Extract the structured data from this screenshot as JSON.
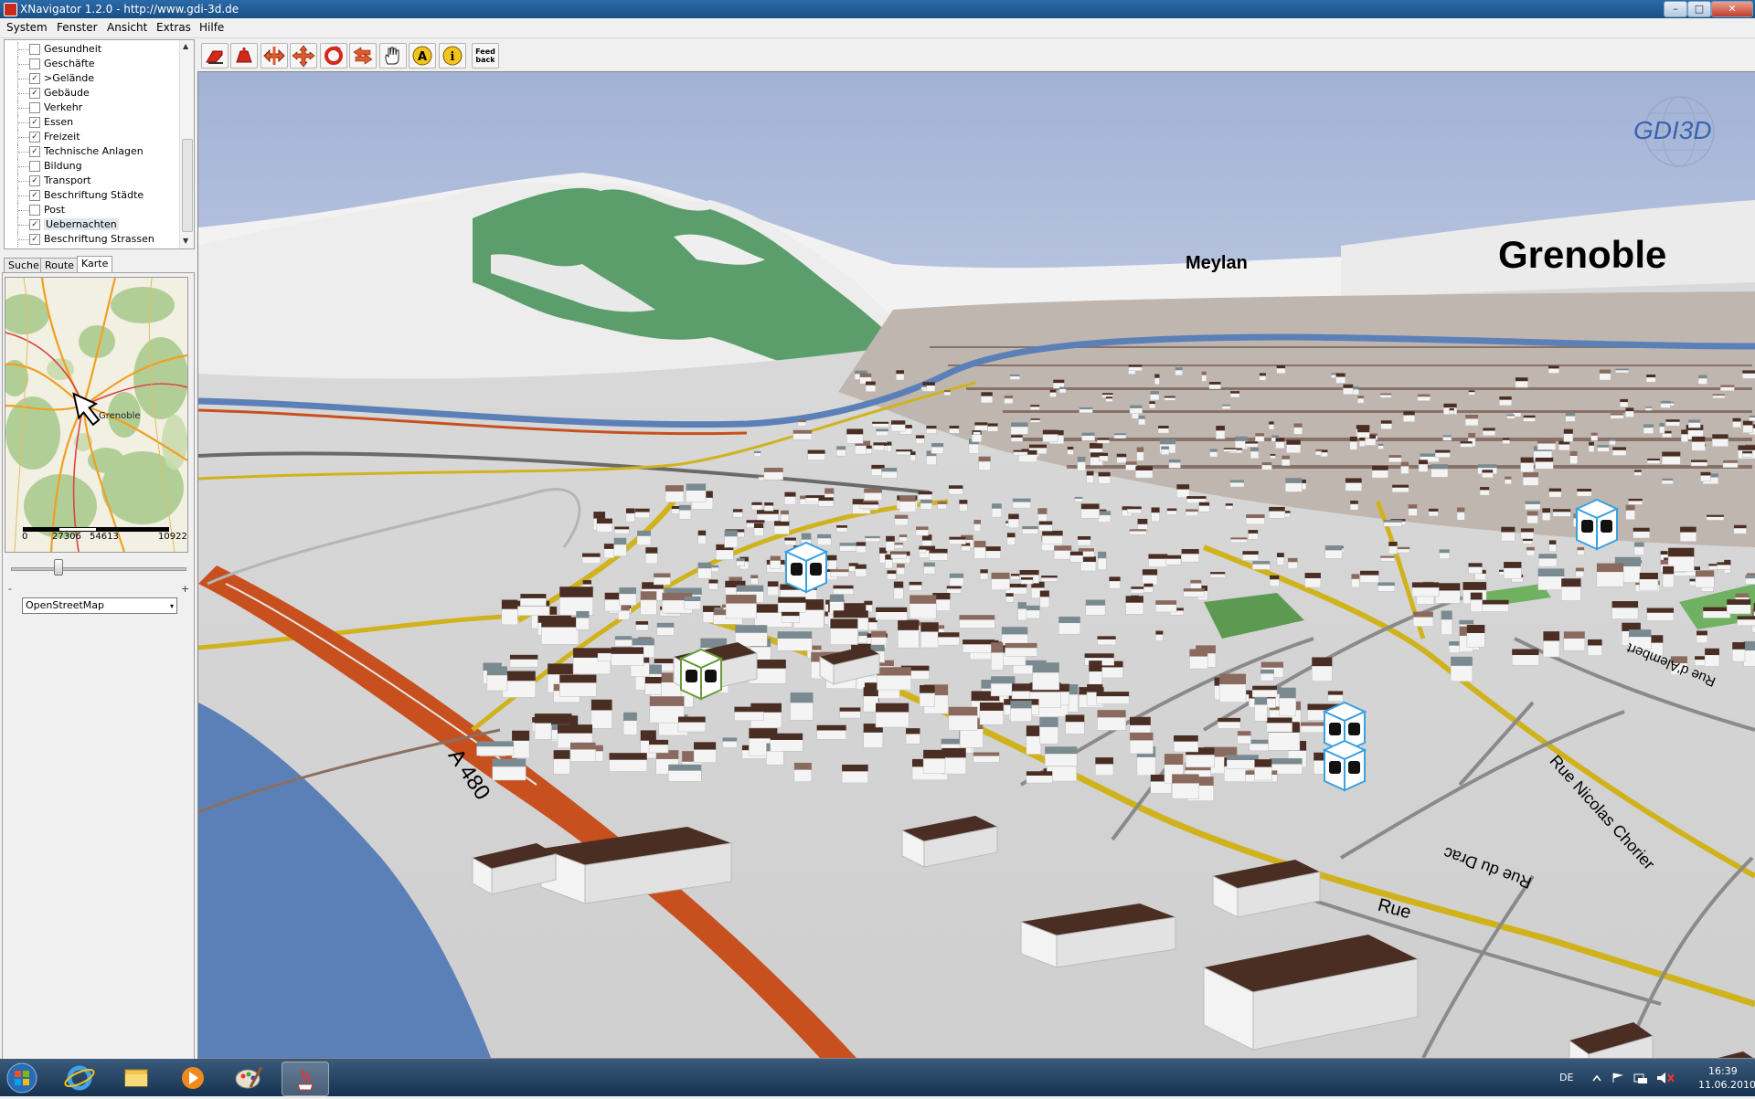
{
  "window": {
    "title": "XNavigator 1.2.0 - http://www.gdi-3d.de"
  },
  "menu": [
    "System",
    "Fenster",
    "Ansicht",
    "Extras",
    "Hilfe"
  ],
  "layers": [
    {
      "label": "Gesundheit",
      "checked": false
    },
    {
      "label": "Geschäfte",
      "checked": false
    },
    {
      "label": ">Gelände",
      "checked": true
    },
    {
      "label": "Gebäude",
      "checked": true
    },
    {
      "label": "Verkehr",
      "checked": false
    },
    {
      "label": "Essen",
      "checked": true
    },
    {
      "label": "Freizeit",
      "checked": true
    },
    {
      "label": "Technische Anlagen",
      "checked": true
    },
    {
      "label": "Bildung",
      "checked": false
    },
    {
      "label": "Transport",
      "checked": true
    },
    {
      "label": "Beschriftung Städte",
      "checked": true
    },
    {
      "label": "Post",
      "checked": false
    },
    {
      "label": "Uebernachten",
      "checked": true,
      "selected": true
    },
    {
      "label": "Beschriftung Strassen",
      "checked": true
    }
  ],
  "tabs": [
    "Suche",
    "Route",
    "Karte"
  ],
  "active_tab": "Karte",
  "minimap": {
    "city_label": "Grenoble",
    "scale": [
      "0",
      "27306",
      "54613",
      "10922"
    ],
    "zoom_minus": "-",
    "zoom_plus": "+",
    "zoom_level": 0.22
  },
  "map_source": {
    "value": "OpenStreetMap",
    "arrow": "▾"
  },
  "toolbar": {
    "icons": [
      "home-view-icon",
      "back-view-icon",
      "pan-lr-icon",
      "move-icon",
      "rotate-icon",
      "undo-icon",
      "hand-icon",
      "annotation-A-icon",
      "info-icon"
    ],
    "feedback_label": "Feed back"
  },
  "view": {
    "logo": "GDI3D",
    "city_labels": [
      "Meylan",
      "Grenoble"
    ],
    "road_labels": [
      "A 480",
      "Rue du Drac",
      "Rue",
      "Rue Nicolas Chorier",
      "Rue d'Alembert"
    ]
  },
  "taskbar": {
    "lang": "DE",
    "time": "16:39",
    "date": "11.06.2010"
  },
  "colors": {
    "titlebar": "#1f5a96",
    "terrain_green": "#5b9e6c",
    "motorway": "#c8501f",
    "river": "#5b80b8",
    "building": "#4a2e24"
  }
}
